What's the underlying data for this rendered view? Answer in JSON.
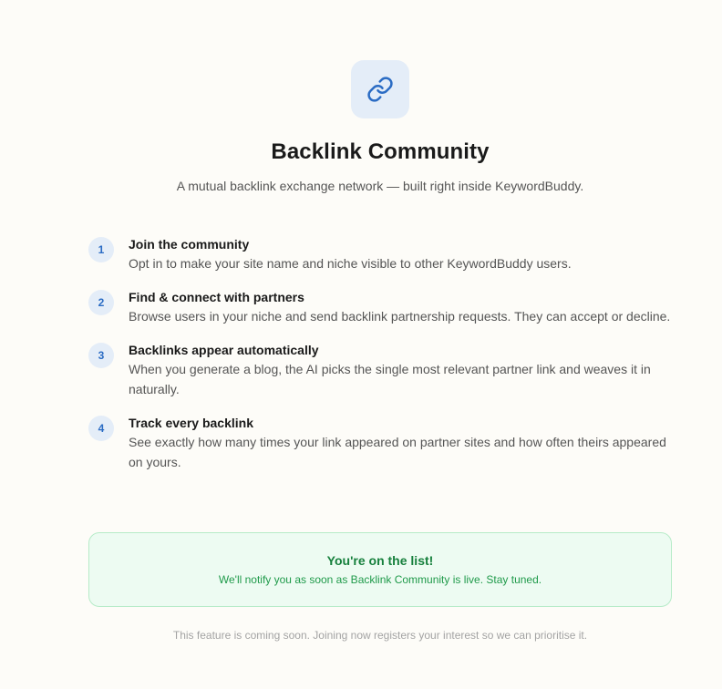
{
  "header": {
    "icon": "link-icon",
    "title": "Backlink Community",
    "subtitle": "A mutual backlink exchange network — built right inside KeywordBuddy."
  },
  "steps": [
    {
      "number": "1",
      "title": "Join the community",
      "description": "Opt in to make your site name and niche visible to other KeywordBuddy users."
    },
    {
      "number": "2",
      "title": "Find & connect with partners",
      "description": "Browse users in your niche and send backlink partnership requests. They can accept or decline."
    },
    {
      "number": "3",
      "title": "Backlinks appear automatically",
      "description": "When you generate a blog, the AI picks the single most relevant partner link and weaves it in naturally."
    },
    {
      "number": "4",
      "title": "Track every backlink",
      "description": "See exactly how many times your link appeared on partner sites and how often theirs appeared on yours."
    }
  ],
  "notice": {
    "title": "You're on the list!",
    "text": "We'll notify you as soon as Backlink Community is live. Stay tuned."
  },
  "footnote": "This feature is coming soon. Joining now registers your interest so we can prioritise it.",
  "colors": {
    "accent": "#2b6cc4",
    "icon_bg": "#e4edf8",
    "success": "#17803d",
    "success_bg": "#edfbf2",
    "success_border": "#b6ebc8"
  }
}
